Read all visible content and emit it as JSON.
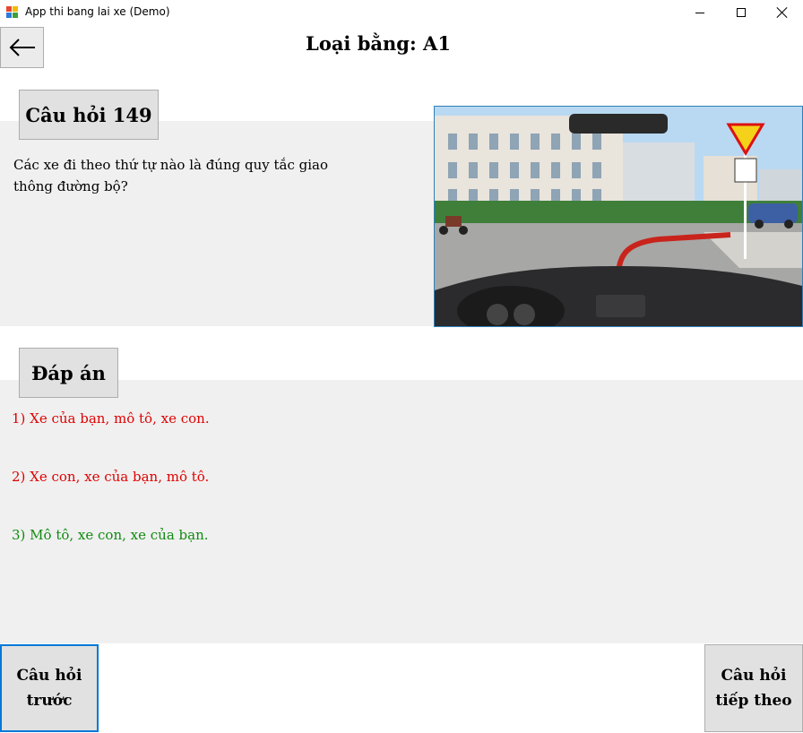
{
  "window": {
    "title": "App thi bang lai xe (Demo)"
  },
  "header": {
    "back_icon": "arrow-left-icon",
    "title": "Loại bằng: A1"
  },
  "question": {
    "label": "Câu hỏi 149",
    "text": "Các xe đi theo thứ tự nào là đúng quy tắc giao thông đường bộ?"
  },
  "answers": {
    "label": "Đáp án",
    "items": [
      {
        "text": "1) Xe của bạn, mô tô, xe con.",
        "color": "#e00000"
      },
      {
        "text": "2) Xe con, xe của bạn, mô tô.",
        "color": "#e00000"
      },
      {
        "text": "3) Mô tô, xe con, xe của bạn.",
        "color": "#108a10"
      }
    ]
  },
  "footer": {
    "prev_label": "Câu hỏi trước",
    "next_label": "Câu hỏi tiếp theo"
  },
  "colors": {
    "panel_bg": "#f0f0f0",
    "button_bg": "#e1e1e1",
    "focus_border": "#0078d7",
    "wrong": "#e00000",
    "correct": "#108a10"
  }
}
